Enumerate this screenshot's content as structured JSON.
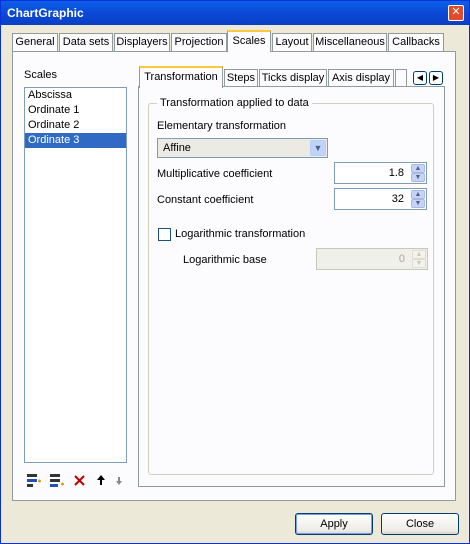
{
  "window": {
    "title": "ChartGraphic",
    "close_glyph": "✕"
  },
  "top_tabs": [
    {
      "label": "General"
    },
    {
      "label": "Data sets"
    },
    {
      "label": "Displayers"
    },
    {
      "label": "Projection"
    },
    {
      "label": "Scales"
    },
    {
      "label": "Layout"
    },
    {
      "label": "Miscellaneous"
    },
    {
      "label": "Callbacks"
    }
  ],
  "active_top_tab": "Scales",
  "scales": {
    "label": "Scales",
    "items": [
      {
        "label": "Abscissa"
      },
      {
        "label": "Ordinate 1"
      },
      {
        "label": "Ordinate 2"
      },
      {
        "label": "Ordinate 3"
      }
    ],
    "selected": "Ordinate 3",
    "toolbar_icons": [
      "add-scale-icon",
      "add-scale-copy-icon",
      "delete-icon",
      "move-up-icon",
      "move-down-icon"
    ]
  },
  "inner_tabs": [
    {
      "label": "Transformation"
    },
    {
      "label": "Steps"
    },
    {
      "label": "Ticks display"
    },
    {
      "label": "Axis display"
    }
  ],
  "active_inner_tab": "Transformation",
  "transformation": {
    "group_title": "Transformation applied to data",
    "elementary_label": "Elementary transformation",
    "elementary_value": "Affine",
    "multiplicative_label": "Multiplicative coefficient",
    "multiplicative_value": "1.8",
    "constant_label": "Constant coefficient",
    "constant_value": "32",
    "log_checkbox_label": "Logarithmic transformation",
    "log_checked": false,
    "log_base_label": "Logarithmic base",
    "log_base_value": "0"
  },
  "buttons": {
    "apply": "Apply",
    "close": "Close"
  },
  "colors": {
    "selection": "#316ac5",
    "titlebar": "#0b49d8",
    "tab_highlight": "#ffc83c"
  }
}
